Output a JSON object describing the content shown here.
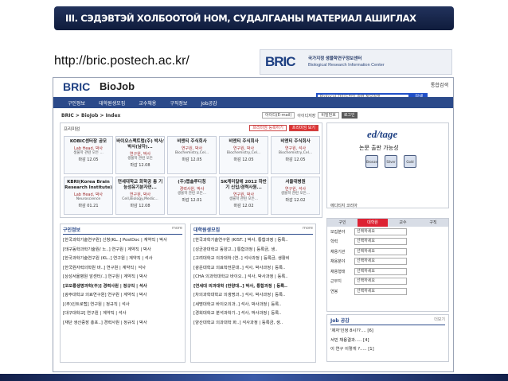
{
  "slide": {
    "banner_title": "III. СЭДЭВТЭЙ ХОЛБООТОЙ НОМ, СУДАЛГААНЫ МАТЕРИАЛ  АШИГЛАХ",
    "url": "http://bric.postech.ac.kr/",
    "logo_mark": "BRIC",
    "logo_korean": "국가지정 생물학연구정보센터",
    "logo_english": "Biological Research Information Center"
  },
  "site": {
    "brand": "BRIC",
    "title": "BioJob",
    "top_links": "통합검색",
    "nav": [
      "구인정보",
      "대학원생모집",
      "교수채용",
      "구직정보",
      "Job공감"
    ],
    "search_placeholder": "Protocol 가이드라인 관련 정보검색",
    "search_button": "검색",
    "breadcrumb": "BRIC > BioJob > Index",
    "login": {
      "id_placeholder": "아이디(E-mail)",
      "pw_placeholder": "비밀번호",
      "save_id": "아이디저장",
      "login_btn": "로그인"
    },
    "panel": {
      "title": "프리미엄",
      "btn1": "프리미엄 등록하기",
      "btn2": "프리미엄 보기"
    },
    "cards": [
      {
        "title": "KOBIC센터장 공모",
        "sub": "Lab Head, 박사",
        "desc": "생물학 관련 모든 ...",
        "deadline": "마감 12.05"
      },
      {
        "title": "바이오스펙트럼(주) 박사/박사(남자)...",
        "sub": "연구원, 박사",
        "desc": "생물학 관련 모든",
        "deadline": "마감 12.08"
      },
      {
        "title": "비앤티 주식회사",
        "sub": "연구원, 박사",
        "desc": "Biochemistry,Cel...",
        "deadline": "마감 12.05"
      },
      {
        "title": "비앤티 주식회사",
        "sub": "연구원, 박사",
        "desc": "Biochemistry,Cel...",
        "deadline": "마감 12.05"
      },
      {
        "title": "비앤티 주식회사",
        "sub": "연구원, 석사",
        "desc": "Biochemistry,Cel...",
        "deadline": "마감 12.05"
      },
      {
        "title": "KBRI(Korea Brain Research Institute)",
        "sub": "Lab Head, 박사",
        "desc": "Neuroscience",
        "deadline": "마감 01.21"
      },
      {
        "title": "연세대학교 화학공 총 기능성유기분자연...",
        "sub": "연구원, 박사",
        "desc": "Cell,Biology,Medic...",
        "deadline": "마감 12.08"
      },
      {
        "title": "(주)랩솔루디칭",
        "sub": "경력사원, 박사",
        "desc": "생물학 관련 모든...",
        "deadline": "마감 12.01"
      },
      {
        "title": "SK케미칼에 2012 하반기 신입/경력사원...",
        "sub": "연구원, 박사",
        "desc": "생물학 관련 모든...",
        "deadline": "마감 12.02"
      },
      {
        "title": "서울대병원",
        "sub": "연구원, 석사",
        "desc": "생물학 관련 모든...",
        "deadline": "마감 12.02"
      }
    ],
    "side": {
      "edtage": "ed/tage",
      "tagline": "논문 출판 가능성",
      "badges": [
        "Bronze",
        "Silver",
        "Gold"
      ],
      "footer": "에디티지 코리아"
    },
    "list1": {
      "title": "구인정보",
      "more": "more",
      "items": [
        "[한국과학기술연구원] 신청(KL..] PostDoc | 계약직 | 박사",
        "[태구동학과학기술원/ 노..] 연구원 | 계약직 | 박사",
        "[한국과학기술연구원 (KL..] 연구원 | 계약직 | 석사",
        "[한국원자력의학원 바..] 연구원 | 계약직 | 석사",
        "[상성서울병원 암센터/..] 연구원 | 계약직 | 박사",
        "[코오롱생명과학(주)] 경력사원 | 정규직 | 석사",
        "[광주대학교 의료연구원] 연구원 | 계약직 | 박사",
        "[(주)인트로랩] 연구원 | 정규직 | 석사",
        "[대구대학교] 연구원 | 계약직 | 석사",
        "[재단 생산증장 총포..] 경력사원 | 정규직 | 박사"
      ]
    },
    "list2": {
      "title": "대학원생모집",
      "more": "more",
      "items": [
        "[한국과학기술연구원 (KIST..] 박사, 통합과정 | 등록..",
        "[성균관대학교 동양고..] 통합과정 | 등록금, 생..",
        "[고려대학교 의과대학 (연..] 석사과정 | 등록금, 생활비",
        "[광운대학교 의료학전문대..] 석사, 박사과정 | 등록..",
        "[CHA 의과학대학교 바이오..] 석사, 박사과정 | 등록..",
        "[연세대 의과대학 (한양대..] 박사, 통합과정 | 등록..",
        "[차의과학대학교 의생명과..] 석사, 박사과정 | 등록..",
        "[세명대학교 바이오의과..] 석사, 박사과정 | 등록..",
        "[경희대학교 분석과학기..] 석사, 박사과정 | 등록..",
        "[양산대학교 의과대학 화..] 석사과정 | 등록금, 생.."
      ]
    },
    "filters": {
      "tabs": [
        "구인",
        "대학원",
        "교수",
        "구직"
      ],
      "rows": [
        {
          "label": "모집분야",
          "value": "선택하세요"
        },
        {
          "label": "학력",
          "value": "선택하세요"
        },
        {
          "label": "채용기관",
          "value": "선택하세요"
        },
        {
          "label": "채용분야",
          "value": "선택하세요"
        },
        {
          "label": "채용형태",
          "value": "선택하세요"
        },
        {
          "label": "근무지",
          "value": "선택하세요"
        },
        {
          "label": "연봉",
          "value": "선택하세요"
        }
      ]
    },
    "jobs": {
      "title": "Job 공감",
      "more": "더보기",
      "items": [
        "'제자'인정 8시??.... [6]",
        "서민 채용결과..... [4]",
        "이 연구 이렇게 ?..... [1]"
      ]
    }
  }
}
